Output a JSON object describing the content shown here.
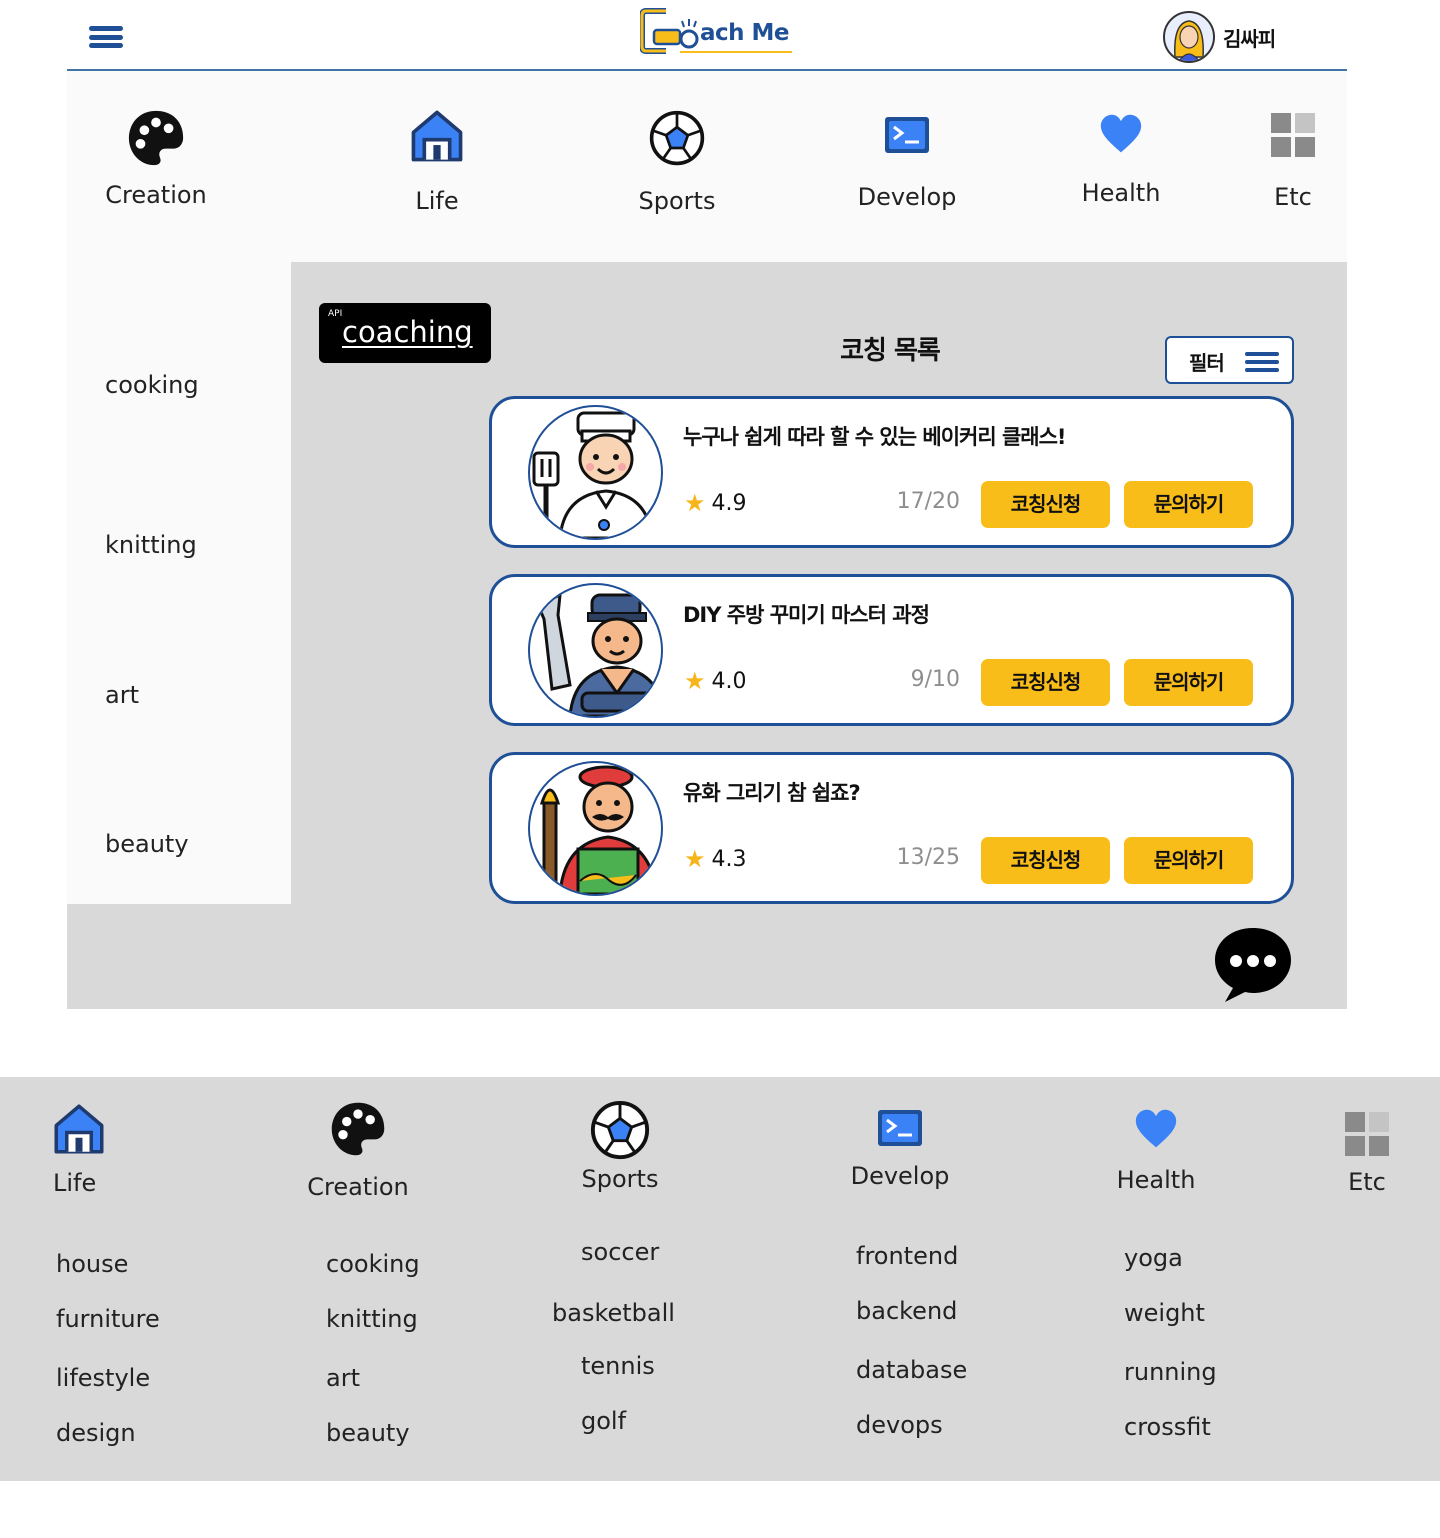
{
  "header": {
    "logo_text": "Coach Me",
    "user_name": "김싸피"
  },
  "categories": [
    {
      "label": "Creation",
      "icon": "palette-icon"
    },
    {
      "label": "Life",
      "icon": "house-icon"
    },
    {
      "label": "Sports",
      "icon": "soccer-ball-icon"
    },
    {
      "label": "Develop",
      "icon": "terminal-icon"
    },
    {
      "label": "Health",
      "icon": "heart-icon"
    },
    {
      "label": "Etc",
      "icon": "grid-icon"
    }
  ],
  "sidebar": {
    "items": [
      "cooking",
      "knitting",
      "art",
      "beauty"
    ]
  },
  "main": {
    "api_tag": "API",
    "chip_label": "coaching",
    "list_title": "코칭 목록",
    "filter_label": "필터",
    "cards": [
      {
        "title": "누구나 쉽게 따라 할 수 있는 베이커리 클래스!",
        "rating": "4.9",
        "count": "17/20",
        "apply_label": "코칭신청",
        "ask_label": "문의하기",
        "avatar": "chef-avatar"
      },
      {
        "title": "DIY 주방 꾸미기 마스터 과정",
        "rating": "4.0",
        "count": "9/10",
        "apply_label": "코칭신청",
        "ask_label": "문의하기",
        "avatar": "mechanic-avatar"
      },
      {
        "title": "유화 그리기 참 쉽죠?",
        "rating": "4.3",
        "count": "13/25",
        "apply_label": "코칭신청",
        "ask_label": "문의하기",
        "avatar": "painter-avatar"
      }
    ]
  },
  "footer": {
    "columns": [
      {
        "title": "Life",
        "icon": "house-icon",
        "links": [
          "house",
          "furniture",
          "lifestyle",
          "design"
        ]
      },
      {
        "title": "Creation",
        "icon": "palette-icon",
        "links": [
          "cooking",
          "knitting",
          "art",
          "beauty"
        ]
      },
      {
        "title": "Sports",
        "icon": "soccer-ball-icon",
        "links": [
          "soccer",
          "basketball",
          "tennis",
          "golf"
        ]
      },
      {
        "title": "Develop",
        "icon": "terminal-icon",
        "links": [
          "frontend",
          "backend",
          "database",
          "devops"
        ]
      },
      {
        "title": "Health",
        "icon": "heart-icon",
        "links": [
          "yoga",
          "weight",
          "running",
          "crossfit"
        ]
      },
      {
        "title": "Etc",
        "icon": "grid-icon",
        "links": []
      }
    ]
  },
  "colors": {
    "primary": "#1f4f96",
    "accent": "#f9bd1a",
    "icon_blue": "#3b82f6",
    "panel_gray": "#d9d9d9"
  }
}
